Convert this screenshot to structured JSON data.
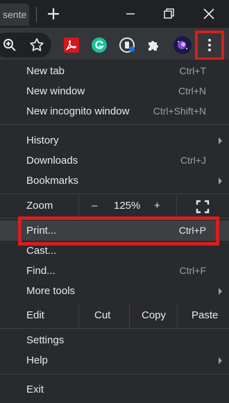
{
  "titlebar": {
    "tab_title": "sente",
    "new_tab_icon": "plus-icon",
    "minimize_icon": "minimize-icon",
    "restore_icon": "restore-icon",
    "close_icon": "close-icon"
  },
  "toolbar": {
    "icons": [
      "zoom-icon",
      "star-icon",
      "adobe-acrobat-icon",
      "grammarly-icon",
      "password-extension-icon",
      "puzzle-icon",
      "profile-avatar-icon",
      "kebab-menu-icon"
    ]
  },
  "menu": {
    "new_tab": {
      "label": "New tab",
      "shortcut": "Ctrl+T"
    },
    "new_window": {
      "label": "New window",
      "shortcut": "Ctrl+N"
    },
    "new_incognito": {
      "label": "New incognito window",
      "shortcut": "Ctrl+Shift+N"
    },
    "history": {
      "label": "History"
    },
    "downloads": {
      "label": "Downloads",
      "shortcut": "Ctrl+J"
    },
    "bookmarks": {
      "label": "Bookmarks"
    },
    "zoom": {
      "label": "Zoom",
      "minus": "–",
      "value": "125%",
      "plus": "+"
    },
    "print": {
      "label": "Print...",
      "shortcut": "Ctrl+P"
    },
    "cast": {
      "label": "Cast..."
    },
    "find": {
      "label": "Find...",
      "shortcut": "Ctrl+F"
    },
    "more_tools": {
      "label": "More tools"
    },
    "edit": {
      "label": "Edit",
      "cut": "Cut",
      "copy": "Copy",
      "paste": "Paste"
    },
    "settings": {
      "label": "Settings"
    },
    "help": {
      "label": "Help"
    },
    "exit": {
      "label": "Exit"
    }
  },
  "colors": {
    "highlight": "#d91d1d",
    "menu_bg": "#292a2d",
    "toolbar_bg": "#35363a"
  }
}
